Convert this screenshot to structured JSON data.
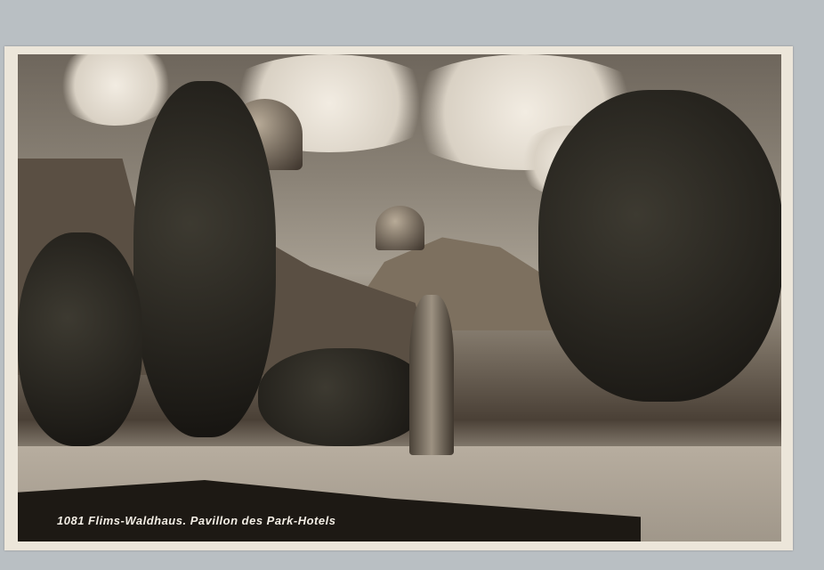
{
  "postcard": {
    "caption": "1081  Flims-Waldhaus. Pavillon des Park-Hotels"
  },
  "colors": {
    "sepia_dark": "#1d1914",
    "sepia_light": "#ece6da"
  }
}
